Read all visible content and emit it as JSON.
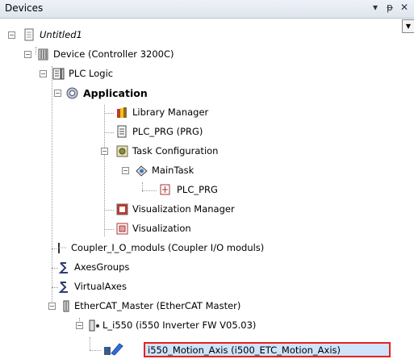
{
  "panel": {
    "title": "Devices",
    "pin_glyph": "▾",
    "pin2_glyph": "ᵖ",
    "close_glyph": "✕"
  },
  "tree": {
    "project": "Untitled1",
    "device": "Device (Controller 3200C)",
    "plc_logic": "PLC Logic",
    "application": "Application",
    "library_manager": "Library Manager",
    "plc_prg": "PLC_PRG (PRG)",
    "task_configuration": "Task Configuration",
    "main_task": "MainTask",
    "main_task_plc_prg": "PLC_PRG",
    "visualization_manager": "Visualization Manager",
    "visualization": "Visualization",
    "coupler": "Coupler_I_O_moduls (Coupler I/O moduls)",
    "axes_groups": "AxesGroups",
    "virtual_axes": "VirtualAxes",
    "ethercat_master": "EtherCAT_Master (EtherCAT Master)",
    "l_i550": "L_i550 (i550 Inverter FW V05.03)",
    "motion_axis": "i550_Motion_Axis (i500_ETC_Motion_Axis)"
  },
  "icons": {
    "project": "document-icon",
    "device": "controller-icon",
    "plc_logic": "plc-logic-icon",
    "application": "gear-icon",
    "library_manager": "books-icon",
    "plc_prg": "program-icon",
    "task_configuration": "task-config-icon",
    "main_task": "task-icon",
    "main_task_plc_prg": "program-call-icon",
    "visualization_manager": "visualization-manager-icon",
    "visualization": "visualization-icon",
    "coupler": "coupler-icon",
    "axes_groups": "axes-groups-icon",
    "virtual_axes": "virtual-axes-icon",
    "ethercat_master": "ethercat-master-icon",
    "l_i550": "drive-icon",
    "motion_axis": "motion-axis-icon"
  },
  "colors": {
    "selection_border": "#e2241f",
    "selection_fill": "#cfe3fb"
  }
}
